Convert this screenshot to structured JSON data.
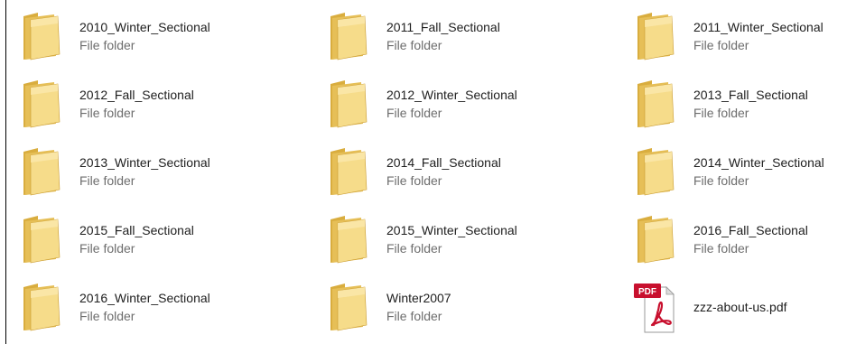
{
  "items": [
    {
      "name": "2010_Winter_Sectional",
      "type": "File folder",
      "icon": "folder-icon"
    },
    {
      "name": "2011_Fall_Sectional",
      "type": "File folder",
      "icon": "folder-icon"
    },
    {
      "name": "2011_Winter_Sectional",
      "type": "File folder",
      "icon": "folder-icon"
    },
    {
      "name": "2012_Fall_Sectional",
      "type": "File folder",
      "icon": "folder-icon"
    },
    {
      "name": "2012_Winter_Sectional",
      "type": "File folder",
      "icon": "folder-icon"
    },
    {
      "name": "2013_Fall_Sectional",
      "type": "File folder",
      "icon": "folder-icon"
    },
    {
      "name": "2013_Winter_Sectional",
      "type": "File folder",
      "icon": "folder-icon"
    },
    {
      "name": "2014_Fall_Sectional",
      "type": "File folder",
      "icon": "folder-icon"
    },
    {
      "name": "2014_Winter_Sectional",
      "type": "File folder",
      "icon": "folder-icon"
    },
    {
      "name": "2015_Fall_Sectional",
      "type": "File folder",
      "icon": "folder-icon"
    },
    {
      "name": "2015_Winter_Sectional",
      "type": "File folder",
      "icon": "folder-icon"
    },
    {
      "name": "2016_Fall_Sectional",
      "type": "File folder",
      "icon": "folder-icon"
    },
    {
      "name": "2016_Winter_Sectional",
      "type": "File folder",
      "icon": "folder-icon"
    },
    {
      "name": "Winter2007",
      "type": "File folder",
      "icon": "folder-icon"
    },
    {
      "name": "zzz-about-us.pdf",
      "icon": "pdf-file-icon",
      "badge": "PDF"
    }
  ],
  "colors": {
    "folder_front": "#f3d37a",
    "folder_back": "#e2b84f",
    "pdf_badge": "#c8102e"
  }
}
